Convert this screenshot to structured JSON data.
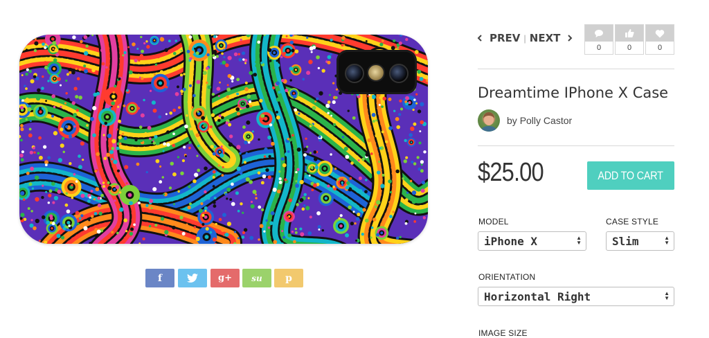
{
  "product": {
    "title": "Dreamtime IPhone X Case",
    "artist_prefix": "by",
    "artist": "Polly Castor",
    "price": "$25.00",
    "add_to_cart": "ADD TO CART"
  },
  "nav": {
    "prev": "PREV",
    "separator": "|",
    "next": "NEXT"
  },
  "counters": [
    {
      "name": "comments",
      "icon": "comment-icon",
      "count": "0"
    },
    {
      "name": "likes",
      "icon": "thumbs-up-icon",
      "count": "0"
    },
    {
      "name": "favorites",
      "icon": "heart-icon",
      "count": "0"
    }
  ],
  "options": {
    "model": {
      "label": "MODEL",
      "value": "iPhone X"
    },
    "case_style": {
      "label": "CASE STYLE",
      "value": "Slim"
    },
    "orientation": {
      "label": "ORIENTATION",
      "value": "Horizontal Right"
    },
    "image_size": {
      "label": "IMAGE SIZE"
    }
  },
  "share": [
    {
      "name": "facebook",
      "glyph": "f",
      "color": "#6b86c6"
    },
    {
      "name": "twitter",
      "glyph": "🐦",
      "color": "#6cc2ef"
    },
    {
      "name": "google-plus",
      "glyph": "g+",
      "color": "#e46b6b"
    },
    {
      "name": "stumbleupon",
      "glyph": "su",
      "color": "#9bd26b"
    },
    {
      "name": "pinterest",
      "glyph": "p",
      "color": "#f2c96e"
    }
  ],
  "colors": {
    "accent": "#4fcfbf"
  }
}
